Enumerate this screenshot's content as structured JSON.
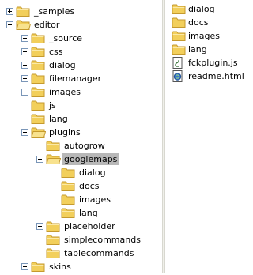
{
  "tree": [
    {
      "label": "_samples",
      "depth": 0,
      "expander": "plus",
      "selected": false
    },
    {
      "label": "editor",
      "depth": 0,
      "expander": "minus",
      "selected": false
    },
    {
      "label": "_source",
      "depth": 1,
      "expander": "plus",
      "selected": false
    },
    {
      "label": "css",
      "depth": 1,
      "expander": "plus",
      "selected": false
    },
    {
      "label": "dialog",
      "depth": 1,
      "expander": "plus",
      "selected": false
    },
    {
      "label": "filemanager",
      "depth": 1,
      "expander": "plus",
      "selected": false
    },
    {
      "label": "images",
      "depth": 1,
      "expander": "plus",
      "selected": false
    },
    {
      "label": "js",
      "depth": 1,
      "expander": "none",
      "selected": false
    },
    {
      "label": "lang",
      "depth": 1,
      "expander": "none",
      "selected": false
    },
    {
      "label": "plugins",
      "depth": 1,
      "expander": "minus",
      "selected": false
    },
    {
      "label": "autogrow",
      "depth": 2,
      "expander": "none",
      "selected": false
    },
    {
      "label": "googlemaps",
      "depth": 2,
      "expander": "minus",
      "selected": true
    },
    {
      "label": "dialog",
      "depth": 3,
      "expander": "none",
      "selected": false
    },
    {
      "label": "docs",
      "depth": 3,
      "expander": "none",
      "selected": false
    },
    {
      "label": "images",
      "depth": 3,
      "expander": "none",
      "selected": false
    },
    {
      "label": "lang",
      "depth": 3,
      "expander": "none",
      "selected": false
    },
    {
      "label": "placeholder",
      "depth": 2,
      "expander": "plus",
      "selected": false
    },
    {
      "label": "simplecommands",
      "depth": 2,
      "expander": "none",
      "selected": false
    },
    {
      "label": "tablecommands",
      "depth": 2,
      "expander": "none",
      "selected": false
    },
    {
      "label": "skins",
      "depth": 1,
      "expander": "plus",
      "selected": false
    }
  ],
  "files": [
    {
      "label": "dialog",
      "icon": "folder-icon"
    },
    {
      "label": "docs",
      "icon": "folder-icon"
    },
    {
      "label": "images",
      "icon": "folder-icon"
    },
    {
      "label": "lang",
      "icon": "folder-icon"
    },
    {
      "label": "fckplugin.js",
      "icon": "script-file-icon"
    },
    {
      "label": "readme.html",
      "icon": "html-file-icon"
    }
  ],
  "colors": {
    "folder": "#f2cf5b",
    "folder_edge": "#c59a2e",
    "selection": "#b8b8b8",
    "expander_border": "#7a96b8"
  }
}
